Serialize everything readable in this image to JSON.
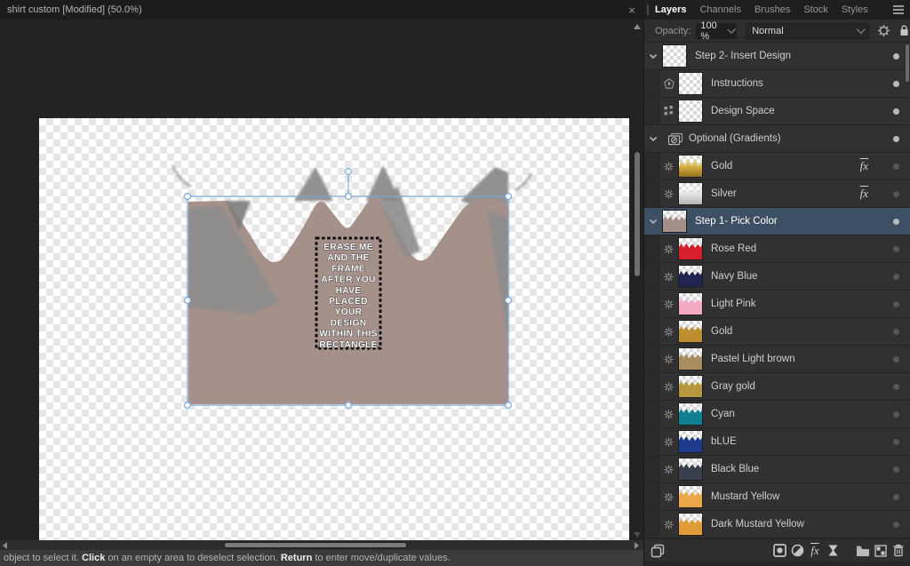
{
  "title_bar": {
    "title": "shirt custom [Modified] (50.0%)",
    "close_label": "×"
  },
  "status_bar": {
    "segments": [
      {
        "text": "object to select it. ",
        "bold": false
      },
      {
        "text": "Click",
        "bold": true
      },
      {
        "text": " on an empty area to deselect selection. ",
        "bold": false
      },
      {
        "text": "Return",
        "bold": true
      },
      {
        "text": " to enter move/duplicate values.",
        "bold": false
      }
    ]
  },
  "panel": {
    "tabs": [
      {
        "label": "Layers",
        "active": true
      },
      {
        "label": "Channels",
        "active": false
      },
      {
        "label": "Brushes",
        "active": false
      },
      {
        "label": "Stock",
        "active": false
      },
      {
        "label": "Styles",
        "active": false
      }
    ],
    "opacity_label": "Opacity:",
    "opacity_value": "100 %",
    "blend_mode": "Normal",
    "fx_label": "fx",
    "layers": [
      {
        "label": "Step 2- Insert Design",
        "type": "group",
        "icon": "chevron-down",
        "thumb": "checker",
        "visible": true,
        "selected": false,
        "fx": false
      },
      {
        "label": "Instructions",
        "type": "child",
        "icon": "shield",
        "thumb": "checker",
        "visible": true,
        "selected": false,
        "fx": false
      },
      {
        "label": "Design Space",
        "type": "child",
        "icon": "dots",
        "thumb": "checker",
        "visible": true,
        "selected": false,
        "fx": false
      },
      {
        "label": "Optional (Gradients)",
        "type": "group",
        "icon": "hidden-stack",
        "thumb": "none",
        "visible": true,
        "selected": false,
        "fx": false
      },
      {
        "label": "Gold",
        "type": "child",
        "icon": "snowflake",
        "thumb": "gold-gradient",
        "visible": false,
        "selected": false,
        "fx": true
      },
      {
        "label": "Silver",
        "type": "child",
        "icon": "snowflake",
        "thumb": "silver-gradient",
        "visible": false,
        "selected": false,
        "fx": true
      },
      {
        "label": "Step 1- Pick Color",
        "type": "group",
        "icon": "chevron-down",
        "thumb": "#a59089",
        "visible": true,
        "selected": true,
        "fx": false
      },
      {
        "label": "Rose Red",
        "type": "child",
        "icon": "snowflake",
        "thumb": "#d6202c",
        "visible": false,
        "selected": false,
        "fx": false
      },
      {
        "label": "Navy Blue",
        "type": "child",
        "icon": "snowflake",
        "thumb": "#21244f",
        "visible": false,
        "selected": false,
        "fx": false
      },
      {
        "label": "Light Pink",
        "type": "child",
        "icon": "snowflake",
        "thumb": "#f2a9c4",
        "visible": false,
        "selected": false,
        "fx": false
      },
      {
        "label": "Gold",
        "type": "child",
        "icon": "snowflake",
        "thumb": "#bd8f2e",
        "visible": false,
        "selected": false,
        "fx": false
      },
      {
        "label": "Pastel Light brown",
        "type": "child",
        "icon": "snowflake",
        "thumb": "#a88d60",
        "visible": false,
        "selected": false,
        "fx": false
      },
      {
        "label": "Gray gold",
        "type": "child",
        "icon": "snowflake",
        "thumb": "#b5983f",
        "visible": false,
        "selected": false,
        "fx": false
      },
      {
        "label": "Cyan",
        "type": "child",
        "icon": "snowflake",
        "thumb": "#107f91",
        "visible": false,
        "selected": false,
        "fx": false
      },
      {
        "label": "bLUE",
        "type": "child",
        "icon": "snowflake",
        "thumb": "#1e3a8c",
        "visible": false,
        "selected": false,
        "fx": false
      },
      {
        "label": "Black Blue",
        "type": "child",
        "icon": "snowflake",
        "thumb": "#3a3f4e",
        "visible": false,
        "selected": false,
        "fx": false
      },
      {
        "label": "Mustard Yellow",
        "type": "child",
        "icon": "snowflake",
        "thumb": "#e9a94a",
        "visible": false,
        "selected": false,
        "fx": false
      },
      {
        "label": "Dark Mustard Yellow",
        "type": "child",
        "icon": "snowflake",
        "thumb": "#df9c38",
        "visible": false,
        "selected": false,
        "fx": false
      }
    ],
    "toolbar_icons": [
      "duplicate-icon",
      "mask-icon",
      "adjustment-icon",
      "fx-icon",
      "live-filter-icon",
      "group-icon",
      "pattern-icon",
      "delete-icon"
    ]
  },
  "canvas": {
    "overlay_text_lines": [
      "ERASE ME",
      "AND THE",
      "FRAME",
      "AFTER YOU",
      "HAVE",
      "PLACED",
      "YOUR",
      "DESIGN",
      "WITHIN THIS",
      "RECTANGLE"
    ],
    "colors": {
      "shirt": "#a5908a",
      "shadow": "#8d8d8d",
      "shadow_dark": "#7d7d7d",
      "selection": "#7aa7d9",
      "pasteboard": "#232323"
    }
  }
}
